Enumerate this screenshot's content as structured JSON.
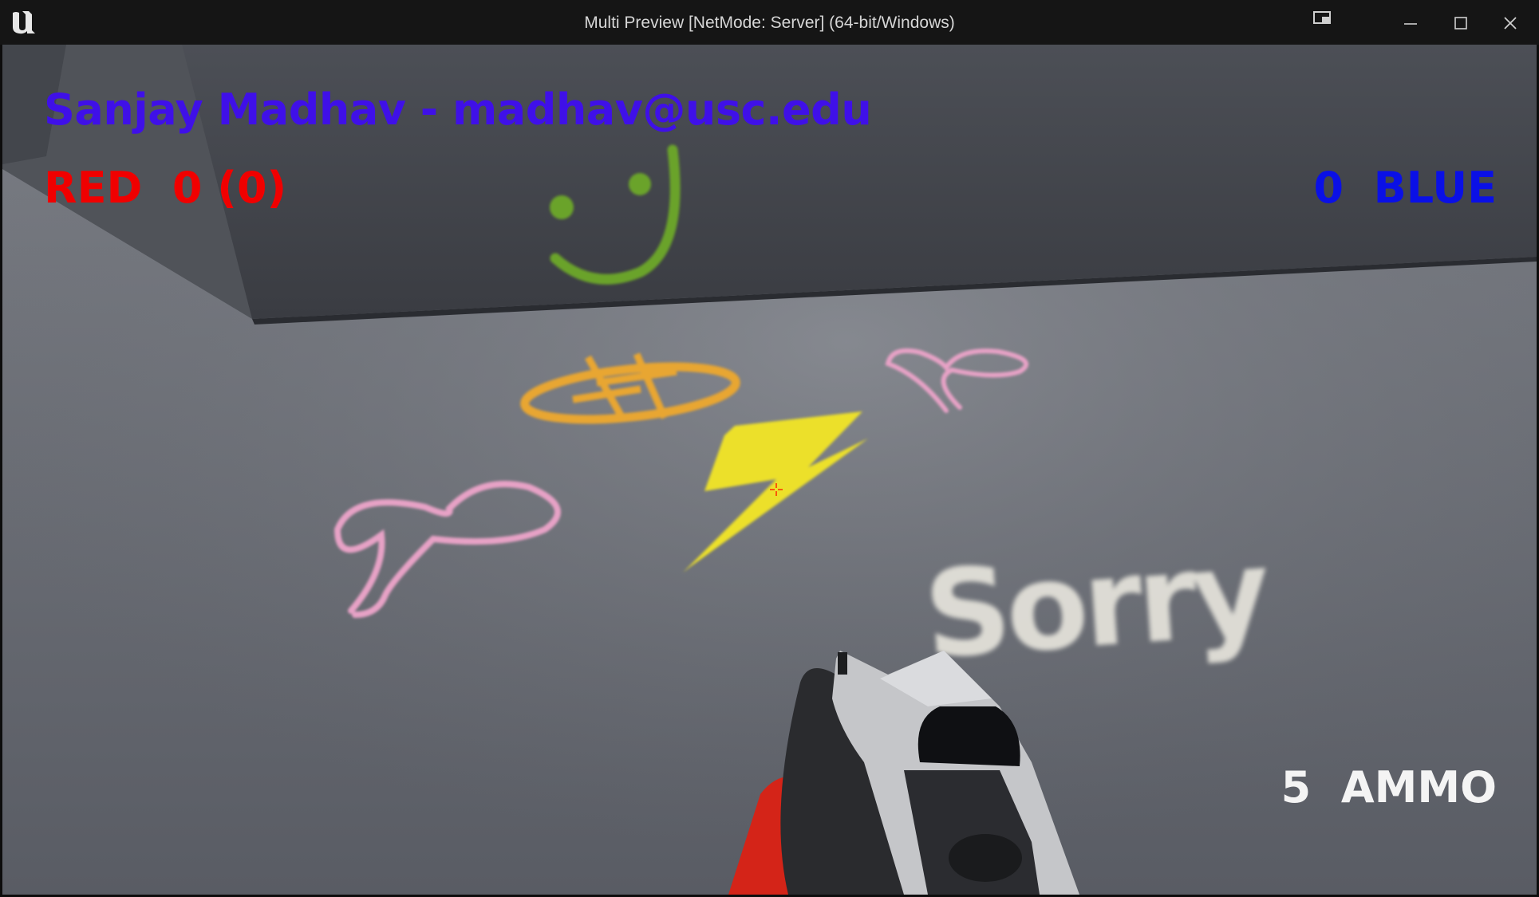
{
  "window": {
    "title": "Multi Preview [NetMode: Server]  (64-bit/Windows)",
    "logo_icon": "unreal-engine-logo-icon",
    "controls": [
      "picture-in-picture-icon",
      "minimize-icon",
      "maximize-icon",
      "close-icon"
    ]
  },
  "hud": {
    "player_name": "Sanjay Madhav - madhav@usc.edu",
    "red_label": "RED",
    "red_score": "0",
    "red_extra": "(0)",
    "red_text": "RED  0 (0)",
    "blue_score": "0",
    "blue_label": "BLUE",
    "blue_text": "0  BLUE",
    "ammo_count": "5",
    "ammo_label": "AMMO",
    "ammo_text": "5  AMMO"
  },
  "scene": {
    "decals": [
      "smiley-face-decal",
      "dollar-sign-decal",
      "heart-decal",
      "lightning-bolt-decal",
      "heart-decal",
      "sorry-text-decal"
    ],
    "sorry_text": "Sorry",
    "colors": {
      "name_text": "#3f10e8",
      "red_team": "#f00000",
      "blue_team": "#0a10e6",
      "ammo_text": "#f4f4f4",
      "smiley": "#6aa32a",
      "dollar": "#e8a630",
      "heart": "#e7a2c6",
      "bolt": "#ece02a",
      "sorry": "#e6e4dc"
    }
  }
}
